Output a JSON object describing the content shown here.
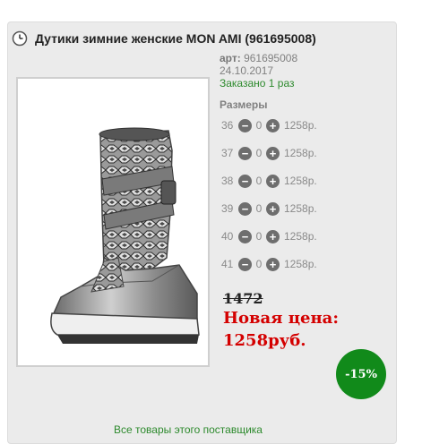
{
  "product": {
    "title": "Дутики зимние женские MON AMI (961695008)",
    "art_label": "арт:",
    "art_value": "961695008",
    "date": "24.10.2017",
    "ordered": "Заказано 1 раз"
  },
  "sizes": {
    "title": "Размеры",
    "rows": [
      {
        "size": "36",
        "qty": "0",
        "price": "1258р."
      },
      {
        "size": "37",
        "qty": "0",
        "price": "1258р."
      },
      {
        "size": "38",
        "qty": "0",
        "price": "1258р."
      },
      {
        "size": "39",
        "qty": "0",
        "price": "1258р."
      },
      {
        "size": "40",
        "qty": "0",
        "price": "1258р."
      },
      {
        "size": "41",
        "qty": "0",
        "price": "1258р."
      }
    ],
    "minus_symbol": "−",
    "plus_symbol": "+"
  },
  "pricing": {
    "old_price": "1472",
    "new_price_label": "Новая цена:",
    "new_price_value": "1258руб.",
    "discount": "-15%"
  },
  "footer": {
    "seller_link": "Все товары этого поставщика"
  },
  "colors": {
    "accent_green": "#118a1a",
    "price_red": "#d40000",
    "ordered_green": "#2d8a2d"
  }
}
